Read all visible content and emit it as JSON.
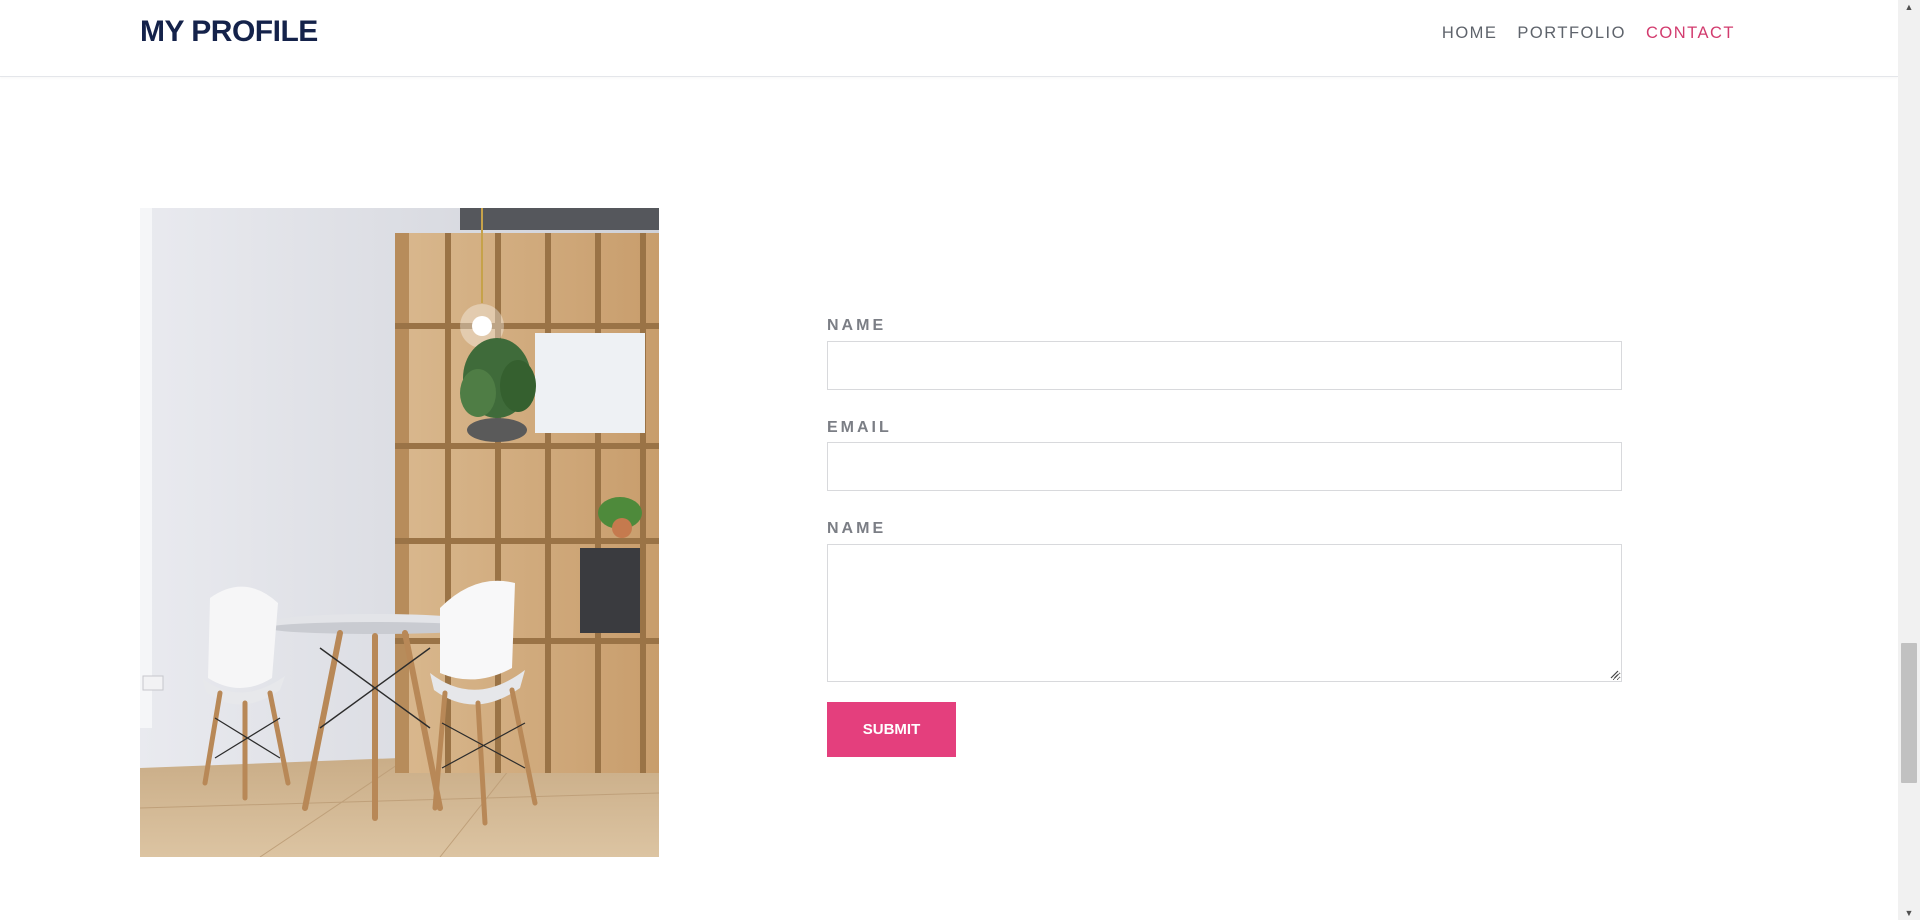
{
  "header": {
    "brand": "MY PROFILE",
    "nav": [
      "HOME",
      "PORTFOLIO",
      "CONTACT"
    ],
    "active_nav": "CONTACT"
  },
  "colors": {
    "brand": "#14224a",
    "accent": "#e43f7d",
    "active_link": "#d23b6e"
  },
  "image": {
    "subject": "office corner with white chairs, round table and wooden shelves"
  },
  "form": {
    "name_label": "NAME",
    "email_label": "EMAIL",
    "message_label": "NAME",
    "name_value": "",
    "email_value": "",
    "message_value": "",
    "submit_label": "SUBMIT"
  },
  "scrollbar": {
    "up_icon": "triangle-up-icon",
    "down_icon": "triangle-down-icon"
  }
}
